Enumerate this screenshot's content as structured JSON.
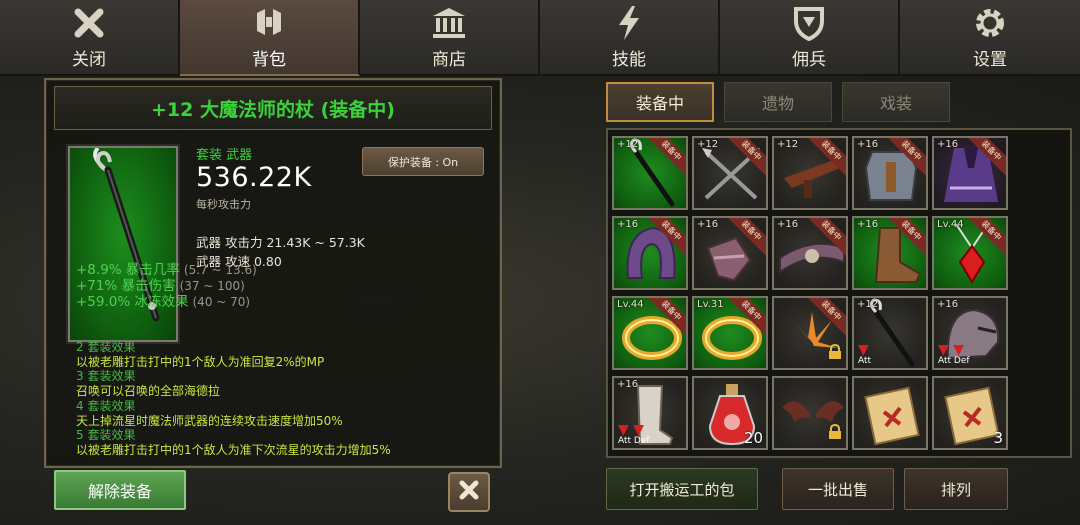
{
  "nav": {
    "tabs": [
      {
        "label": "关闭",
        "icon": "close-icon"
      },
      {
        "label": "背包",
        "icon": "backpack-icon",
        "active": true
      },
      {
        "label": "商店",
        "icon": "shop-icon"
      },
      {
        "label": "技能",
        "icon": "lightning-icon"
      },
      {
        "label": "佣兵",
        "icon": "shield-icon"
      },
      {
        "label": "设置",
        "icon": "gear-icon"
      }
    ]
  },
  "detail": {
    "title": "+12 大魔法师的杖 (装备中)",
    "set_type": "套装 武器",
    "attack_value": "536.22K",
    "attack_caption": "每秒攻击力",
    "protect_button": "保护装备 : On",
    "weapon_attack": "武器 攻击力 21.43K ~ 57.3K",
    "weapon_speed": "武器 攻速 0.80",
    "stats": [
      {
        "text": "+8.9% 暴击几率",
        "range": "(5.7 ~ 13.6)"
      },
      {
        "text": "+71% 暴击伤害",
        "range": "(37 ~ 100)"
      },
      {
        "text": "+59.0% 冰冻效果",
        "range": "(40 ~ 70)"
      }
    ],
    "set_effects": [
      {
        "head": "2 套装效果",
        "body": "以被老雕打击打中的1个敌人为准回复2%的MP"
      },
      {
        "head": "3 套装效果",
        "body": "召唤可以召唤的全部海德拉"
      },
      {
        "head": "4 套装效果",
        "body": "天上掉流星时魔法师武器的连续攻击速度增加50%"
      },
      {
        "head": "5 套装效果",
        "body": "以被老雕打击打中的1个敌人为准下次流星的攻击力增加5%"
      }
    ],
    "unequip_button": "解除装备"
  },
  "inventory": {
    "tabs": [
      "装备中",
      "遗物",
      "戏装"
    ],
    "active_tab": "装备中",
    "equipped_ribbon": "装备中",
    "slots": [
      {
        "plus": "+12",
        "equipped": true,
        "bg": "green",
        "icon": "staff-icon"
      },
      {
        "plus": "+12",
        "equipped": true,
        "bg": "dark",
        "icon": "crossed-arrows-icon"
      },
      {
        "plus": "+12",
        "equipped": true,
        "bg": "dark",
        "icon": "crossbow-icon"
      },
      {
        "plus": "+16",
        "equipped": true,
        "bg": "dark",
        "icon": "armor-icon"
      },
      {
        "plus": "+16",
        "equipped": true,
        "bg": "purple",
        "icon": "cape-icon"
      },
      {
        "plus": "+16",
        "equipped": true,
        "bg": "green",
        "icon": "hood-icon"
      },
      {
        "plus": "+16",
        "equipped": true,
        "bg": "dark",
        "icon": "gauntlet-icon"
      },
      {
        "plus": "+16",
        "equipped": true,
        "bg": "dark",
        "icon": "belt-icon"
      },
      {
        "plus": "+16",
        "equipped": true,
        "bg": "green",
        "icon": "boots-icon"
      },
      {
        "plus": "Lv.44",
        "equipped": true,
        "bg": "green",
        "icon": "amulet-icon"
      },
      {
        "plus": "Lv.44",
        "equipped": true,
        "bg": "green",
        "icon": "ring-icon"
      },
      {
        "plus": "Lv.31",
        "equipped": true,
        "bg": "green",
        "icon": "ring-icon"
      },
      {
        "plus": "",
        "equipped": true,
        "bg": "dark",
        "icon": "burst-icon",
        "locked": true
      },
      {
        "plus": "+12",
        "equipped": false,
        "bg": "dark",
        "icon": "staff-icon",
        "down": "Att"
      },
      {
        "plus": "+16",
        "equipped": false,
        "bg": "dark",
        "icon": "helmet-icon",
        "down": "Att Def"
      },
      {
        "plus": "+16",
        "equipped": false,
        "bg": "dark",
        "icon": "greaves-icon",
        "down": "Att Def"
      },
      {
        "plus": "",
        "equipped": false,
        "bg": "dark",
        "icon": "potion-icon",
        "count": "20"
      },
      {
        "plus": "",
        "equipped": false,
        "bg": "dark",
        "icon": "wings-icon",
        "locked": true
      },
      {
        "plus": "",
        "equipped": false,
        "bg": "dark",
        "icon": "scroll-icon"
      },
      {
        "plus": "",
        "equipped": false,
        "bg": "dark",
        "icon": "scroll-icon",
        "count": "3"
      }
    ],
    "buttons": {
      "open_porter": "打开搬运工的包",
      "sell_batch": "一批出售",
      "sort": "排列"
    }
  },
  "colors": {
    "set_green": "#3bd23b",
    "effect_yellow": "#c8e840",
    "nav_active": "#423730",
    "equip_ribbon": "#7a2a22"
  }
}
